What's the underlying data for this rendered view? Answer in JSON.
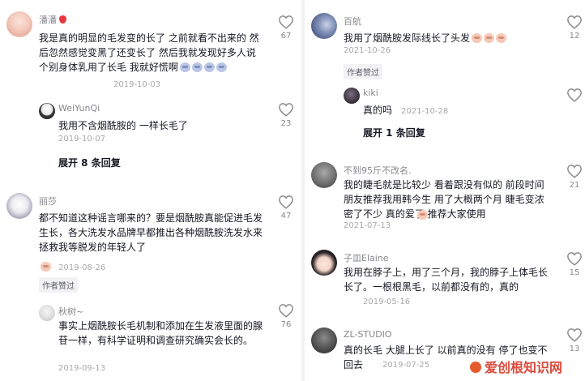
{
  "left_column": {
    "comment1": {
      "author": "潘潘",
      "text": "我是真的明显的毛发变的长了 之前就看不出来的 然后忽然感觉变黑了还变长了 然后我就发现好多人说个别身体乳用了长毛 我就好慌啊",
      "date": "2019-10-03",
      "likes": "67",
      "author_icon": "strawberry-emoji",
      "text_emojis": [
        "scream-emoji",
        "scream-emoji",
        "scream-emoji",
        "scream-emoji"
      ],
      "reply": {
        "author": "WeiYunQi",
        "text": "我用不含烟酰胺的 一样长毛了",
        "date": "2019-10-07",
        "likes": "23"
      },
      "expand_label": "展开 8 条回复"
    },
    "comment2": {
      "author": "丽莎",
      "text": "都不知道这种谣言哪来的？要是烟酰胺真能促进毛发生长，各大洗发水品牌早都推出各种烟酰胺洗发水来拯救我等脱发的年轻人了",
      "text_emoji": "grin-emoji",
      "date": "2019-08-26",
      "likes": "47",
      "badge": "作者赞过",
      "reply": {
        "author": "秋树~",
        "text": "事实上烟酰胺长毛机制和添加在生发液里面的腺苷一样，有科学证明和调查研究确实会长的。",
        "date": "2019-09-13",
        "likes": "76"
      }
    }
  },
  "right_column": {
    "comment1": {
      "author": "百航",
      "text": "我用了烟酰胺发际线长了头发",
      "text_emojis": [
        "grin-emoji",
        "grin-emoji",
        "grin-emoji"
      ],
      "date": "2021-10-26",
      "likes": "12",
      "badge": "作者赞过",
      "reply": {
        "author": "kiki",
        "text": "真的吗",
        "date": "2021-10-28",
        "likes": ""
      },
      "expand_label": "展开 1 条回复"
    },
    "comment2": {
      "author": "不到95斤不改名.",
      "text": "我的睫毛就是比较少 看着跟没有似的 前段时间朋友推荐我用韩今生 用了大概两个月 睫毛变浓密了不少 真的爱了 推荐大家使用",
      "text_emoji": "grin-emoji",
      "date": "2021-07-13",
      "likes": "21"
    },
    "comment3": {
      "author": "子皿Elaine",
      "text": "我用在脖子上，用了三个月，我的脖子上体毛长长了。一根根黑毛，以前都没有的，真的",
      "date": "2019-05-16",
      "likes": "15"
    },
    "comment4": {
      "author": "ZL-STUDIO",
      "text": "真的长毛 大腿上长了 以前真的没有 停了也变不回去",
      "date": "2019-07-25",
      "likes": "13"
    }
  },
  "watermark": {
    "text": "爱创根知识网"
  },
  "colors": {
    "name": "#86878b",
    "text": "#161823",
    "date": "#a7a8ab",
    "badge_bg": "#f2f2f4",
    "separator": "#f1f1f2",
    "watermark": "#d94a3a"
  }
}
